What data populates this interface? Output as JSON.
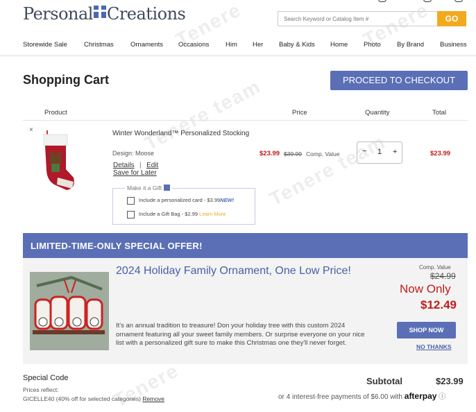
{
  "header": {
    "logo_text_a": "Personal",
    "logo_text_b": "Creations",
    "search_placeholder": "Search Keyword or Catalog Item #",
    "search_go": "GO"
  },
  "nav": [
    "Storewide Sale",
    "Christmas",
    "Ornaments",
    "Occasions",
    "Him",
    "Her",
    "Baby & Kids",
    "Home",
    "Photo",
    "By Brand",
    "Business"
  ],
  "cart": {
    "title": "Shopping Cart",
    "checkout_label": "PROCEED TO CHECKOUT",
    "col_product": "Product",
    "col_price": "Price",
    "col_quantity": "Quantity",
    "col_total": "Total",
    "item": {
      "remove": "×",
      "name": "Winter Wonderland™ Personalized Stocking",
      "design": "Design: Moose",
      "details": "Details",
      "sep": "|",
      "edit": "Edit",
      "save_later": "Save for Later",
      "price": "$23.99",
      "old_price": "$39.99",
      "comp_value": "Comp. Value",
      "qty_minus": "−",
      "qty": "1",
      "qty_plus": "+",
      "total": "$23.99"
    },
    "gift": {
      "label": "Make it a Gift",
      "card_text": "Include a personalized card - $3.99",
      "card_new": "NEW!",
      "bag_text": "Include a Gift Bag - $2.99",
      "bag_learn": "Learn More"
    }
  },
  "offer": {
    "banner": "LIMITED-TIME-ONLY SPECIAL OFFER!",
    "title": "2024 Holiday Family Ornament, One Low Price!",
    "description": "It's an annual tradition to treasure! Don your holiday tree with this custom 2024 ornament featuring all your sweet family members. Or surprise everyone on your nice list with a personalized gift sure to make this Christmas one they'll never forget.",
    "comp_value_label": "Comp. Value",
    "old_price": "$24.99",
    "now_only": "Now Only",
    "price": "$12.49",
    "shop_now": "SHOP NOW",
    "no_thanks": "NO THANKS"
  },
  "summary": {
    "special_code": "Special Code",
    "prices_reflect": "Prices reflect:",
    "code_text": "GICELLE40 (40% off for selected categories)",
    "remove": "Remove",
    "subtotal_label": "Subtotal",
    "subtotal_value": "$23.99",
    "afterpay_text": "or 4 interest-free payments of $6.00 with",
    "afterpay_brand": "afterpay",
    "afterpay_info": "ⓘ"
  },
  "colors": {
    "accent": "#5a6fb6",
    "go": "#f2a91e",
    "price_red": "#c01b1b"
  }
}
